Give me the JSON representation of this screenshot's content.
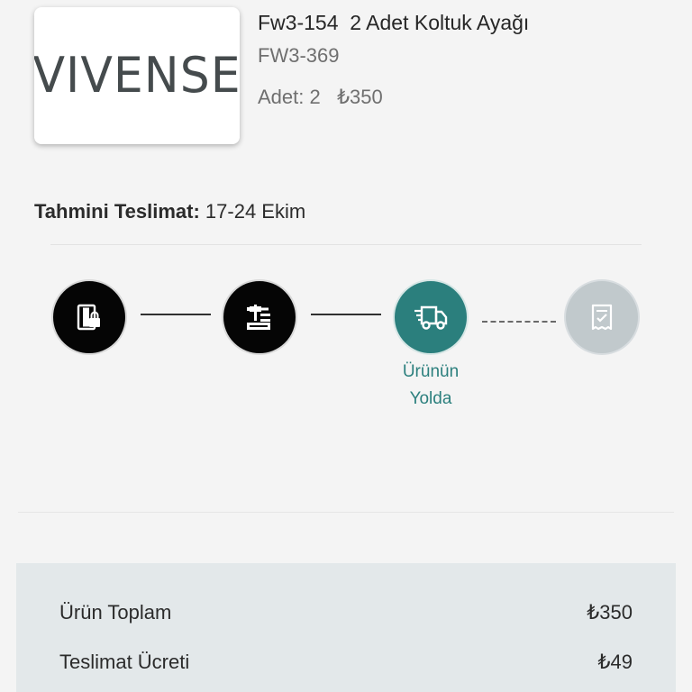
{
  "product": {
    "brand_logo": "VIVENSE",
    "title": "Fw3-154  2 Adet Koltuk Ayağı",
    "code": "FW3-369",
    "qty_label": "Adet: 2",
    "price": "₺350"
  },
  "delivery": {
    "label": "Tahmini Teslimat:",
    "value": "17-24 Ekim"
  },
  "tracker": {
    "steps": [
      {
        "icon": "order-lock-icon",
        "state": "done",
        "label": ""
      },
      {
        "icon": "production-icon",
        "state": "done",
        "label": ""
      },
      {
        "icon": "delivery-truck-icon",
        "state": "active",
        "label_line1": "Ürünün",
        "label_line2": "Yolda"
      },
      {
        "icon": "receipt-check-icon",
        "state": "pending",
        "label": ""
      }
    ],
    "colors": {
      "done": "#050505",
      "active": "#2b7f7d",
      "pending": "#c1c9cc"
    }
  },
  "summary": {
    "rows": [
      {
        "label": "Ürün Toplam",
        "value": "₺350"
      },
      {
        "label": "Teslimat Ücreti",
        "value": "₺49"
      }
    ]
  }
}
